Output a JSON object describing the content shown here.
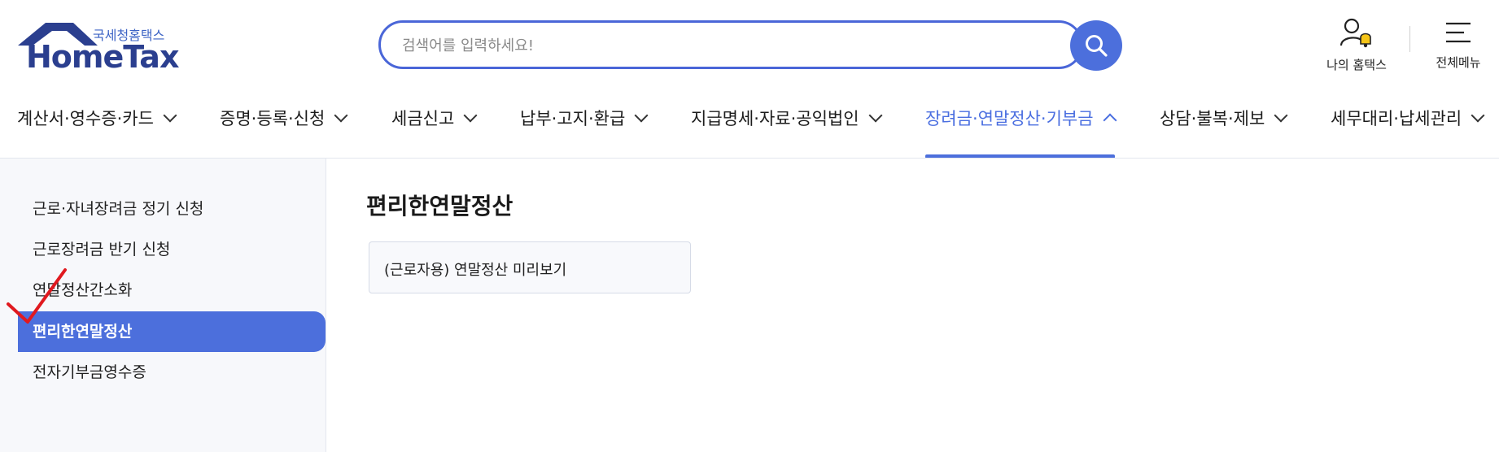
{
  "header": {
    "logo_kr": "국세청홈택스",
    "logo_en": "HomeTax",
    "search_placeholder": "검색어를 입력하세요!",
    "my_hometax_label": "나의 홈택스",
    "all_menu_label": "전체메뉴",
    "accent_color": "#4c6fdc"
  },
  "nav": {
    "items": [
      {
        "label": "계산서·영수증·카드",
        "active": false
      },
      {
        "label": "증명·등록·신청",
        "active": false
      },
      {
        "label": "세금신고",
        "active": false
      },
      {
        "label": "납부·고지·환급",
        "active": false
      },
      {
        "label": "지급명세·자료·공익법인",
        "active": false
      },
      {
        "label": "장려금·연말정산·기부금",
        "active": true
      },
      {
        "label": "상담·불복·제보",
        "active": false
      },
      {
        "label": "세무대리·납세관리",
        "active": false
      }
    ]
  },
  "sidebar": {
    "items": [
      {
        "label": "근로·자녀장려금 정기 신청",
        "active": false
      },
      {
        "label": "근로장려금 반기 신청",
        "active": false
      },
      {
        "label": "연말정산간소화",
        "active": false
      },
      {
        "label": "편리한연말정산",
        "active": true
      },
      {
        "label": "전자기부금영수증",
        "active": false
      }
    ]
  },
  "main": {
    "title": "편리한연말정산",
    "card_label": "(근로자용) 연말정산 미리보기"
  },
  "icons": {
    "search": "search-icon",
    "my_hometax": "user-bell-icon",
    "all_menu": "hamburger-menu-icon",
    "check": "red-checkmark-icon"
  }
}
